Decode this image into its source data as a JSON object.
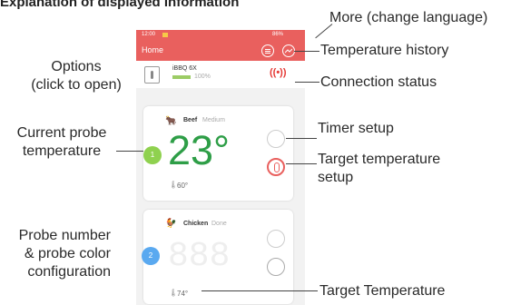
{
  "heading": "Explanation of displayed information",
  "phone": {
    "status_time": "12:00",
    "status_right": "86%",
    "app_title": "Home",
    "device_name": "iBBQ 6X",
    "battery": "100%"
  },
  "probes": [
    {
      "number": "1",
      "name": "Beef",
      "state": "Medium",
      "temp": "23°",
      "target": "60°",
      "color": "#8fd14f"
    },
    {
      "number": "2",
      "name": "Chicken",
      "state": "Done",
      "temp": "888",
      "target": "74°",
      "color": "#5aa9f0"
    }
  ],
  "callouts": {
    "more": "More (change language)",
    "history": "Temperature history",
    "connection": "Connection status",
    "options_1": "Options",
    "options_2": "(click to open)",
    "current_1": "Current probe",
    "current_2": "temperature",
    "timer": "Timer setup",
    "target_setup_1": "Target temperature",
    "target_setup_2": "setup",
    "probe_num_1": "Probe number",
    "probe_num_2": "& probe color",
    "probe_num_3": "configuration",
    "target_temp": "Target Temperature"
  },
  "colors": {
    "accent": "#e9605e",
    "alert": "#e9605e",
    "connection": "#e53935"
  }
}
